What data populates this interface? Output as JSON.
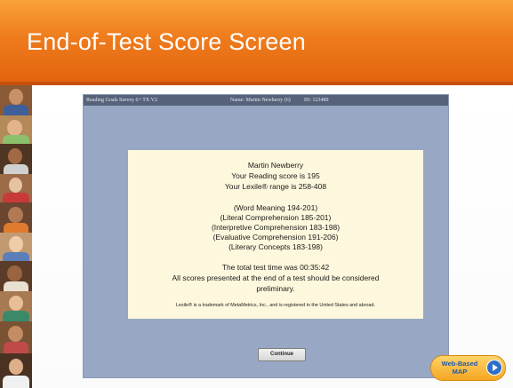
{
  "slide": {
    "title": "End-of-Test Score Screen"
  },
  "status_bar": {
    "test_name": "Reading Goals Survey 6+ TX V2",
    "student_name": "Name: Martin Newberry (6)",
    "student_id": "ID: 123489"
  },
  "score_panel": {
    "student": "Martin Newberry",
    "reading_score": "Your Reading score is 195",
    "lexile_range": "Your Lexile® range is 258-408",
    "goals": [
      "(Word Meaning 194-201)",
      "(Literal Comprehension 185-201)",
      "(Interpretive Comprehension 183-198)",
      "(Evaluative Comprehension 191-206)",
      "(Literary Concepts 183-198)"
    ],
    "total_time": "The total test time was 00:35:42",
    "disclaimer_1": "All scores presented at the end of a test should be considered",
    "disclaimer_2": "preliminary.",
    "trademark": "Lexile® is a trademark of MetaMetrics, Inc., and is registered in the United States and abroad."
  },
  "continue_label": "Continue",
  "badge": {
    "line1": "Web-Based",
    "line2": "MAP",
    "icon": "play-arrow-icon"
  },
  "colors": {
    "title_orange": "#ee7b1c",
    "window_blue": "#98a8c4",
    "panel_cream": "#fdf7dd",
    "badge_yellow": "#f5a623",
    "badge_blue": "#1e58a8"
  }
}
